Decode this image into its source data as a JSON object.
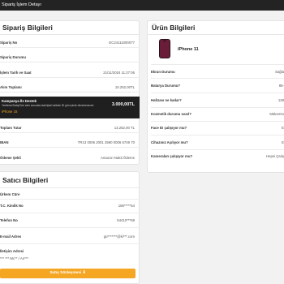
{
  "header": {
    "title": "Sipariş İşlem Detayı"
  },
  "order": {
    "title": "Sipariş Bilgileri",
    "rows": [
      {
        "label": "Sipariş No",
        "value": "EC24111000077"
      },
      {
        "label": "Sipariş Durumu",
        "value": ""
      },
      {
        "label": "İşlem Tarih ve Saat",
        "value": "21/11/2024 11:27:06"
      },
      {
        "label": "Alım Toplamı",
        "value": "10.252,00TL"
      }
    ],
    "campaign": {
      "title": "Kampanya İle Destek",
      "note": "Yenileme/Satış/Geri alım sonunda iade/iptal halinde 30 gün içinde düzenlenecek",
      "product": "iPhone 15",
      "value": "3.000,00TL"
    },
    "rows2": [
      {
        "label": "Toplam Tutar",
        "value": "13.252,00 TL"
      },
      {
        "label": "IBAN",
        "value": "TR13 0006 2001 2590 0006 6749 70"
      },
      {
        "label": "Ödeme Şekli",
        "value": "Amazon Nakit Ödeme"
      }
    ]
  },
  "seller": {
    "title": "Satıcı Bilgileri",
    "rows": [
      {
        "label": "Ürkem Cüre",
        "value": ""
      },
      {
        "label": "T.C. Kimlik No",
        "value": "186*****54"
      },
      {
        "label": "Telefon No",
        "value": "54410***69"
      },
      {
        "label": "E-mail Adres",
        "value": "gü*******@ki***.com"
      },
      {
        "label": "İletişim Adresi",
        "value": ""
      }
    ],
    "address": "*** *** Mc** / An***",
    "contract_button": "Satış Sözleşmesi ⬇"
  },
  "product": {
    "title": "Ürün Bilgileri",
    "name": "iPhone 11",
    "rows": [
      {
        "label": "Ekran Durumu",
        "value": "Sağla"
      },
      {
        "label": "Batarya Durumu?",
        "value": "85-"
      },
      {
        "label": "Hafızası ne kadar?",
        "value": "128"
      },
      {
        "label": "Kozmetik durumu nasıl?",
        "value": "Mükemm"
      },
      {
        "label": "Face ID çalışıyor mu?",
        "value": "E"
      },
      {
        "label": "Cihazınız Açılıyor mu?",
        "value": "E"
      },
      {
        "label": "Kameraları çalışıyor mu?",
        "value": "Hepsi Çalış"
      }
    ]
  }
}
